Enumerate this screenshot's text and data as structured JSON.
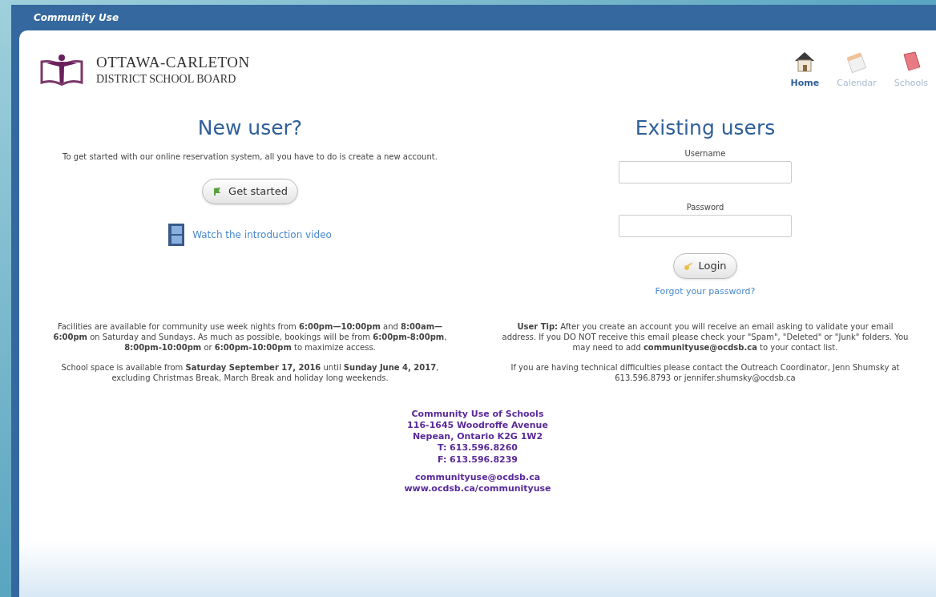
{
  "window": {
    "title": "Community Use"
  },
  "logo": {
    "line_1": "OTTAWA-CARLETON",
    "line_2": "DISTRICT SCHOOL BOARD"
  },
  "nav": [
    {
      "label": "Home",
      "kind": "home",
      "selected": true
    },
    {
      "label": "Calendar",
      "kind": "calendar",
      "selected": false
    },
    {
      "label": "Schools",
      "kind": "schools",
      "selected": false
    }
  ],
  "new_user": {
    "heading": "New user?",
    "intro": "To get started with our online reservation system, all you have to do is create a new account.",
    "button": "Get started",
    "video_link": "Watch the introduction video"
  },
  "existing_users": {
    "heading": "Existing users",
    "username": {
      "label": "Username"
    },
    "password": {
      "label": "Password"
    },
    "button": "Login",
    "forgot_link": "Forgot your password?"
  },
  "info_left": [
    "Facilities are available for community use week nights from **6:00pm—10:00pm** and **8:00am—6:00pm** on Saturday and Sundays. As much as possible, bookings will be from **6:00pm-8:00pm**, **8:00pm-10:00pm** or **6:00pm-10:00pm** to maximize access.",
    "School space is available from **Saturday September 17, 2016** until **Sunday June 4, 2017**, excluding Christmas Break, March Break and holiday long weekends."
  ],
  "info_right": [
    "**User Tip:** After you create an account you will receive an email asking to validate your email address. If you DO NOT receive this email please check your \"Spam\", \"Deleted\" or \"Junk\" folders. You  may need to add **communityuse@ocdsb.ca** to your contact list.",
    "If you are having technical difficulties please contact the Outreach Coordinator, Jenn Shumsky at 613.596.8793 or jennifer.shumsky@ocdsb.ca"
  ],
  "contact": {
    "address": [
      "Community Use of Schools",
      "116-1645 Woodroffe Avenue",
      "Nepean, Ontario K2G 1W2",
      "T: 613.596.8260",
      "F: 613.596.8239"
    ],
    "email": "communityuse@ocdsb.ca",
    "website": "www.ocdsb.ca/communityuse"
  }
}
